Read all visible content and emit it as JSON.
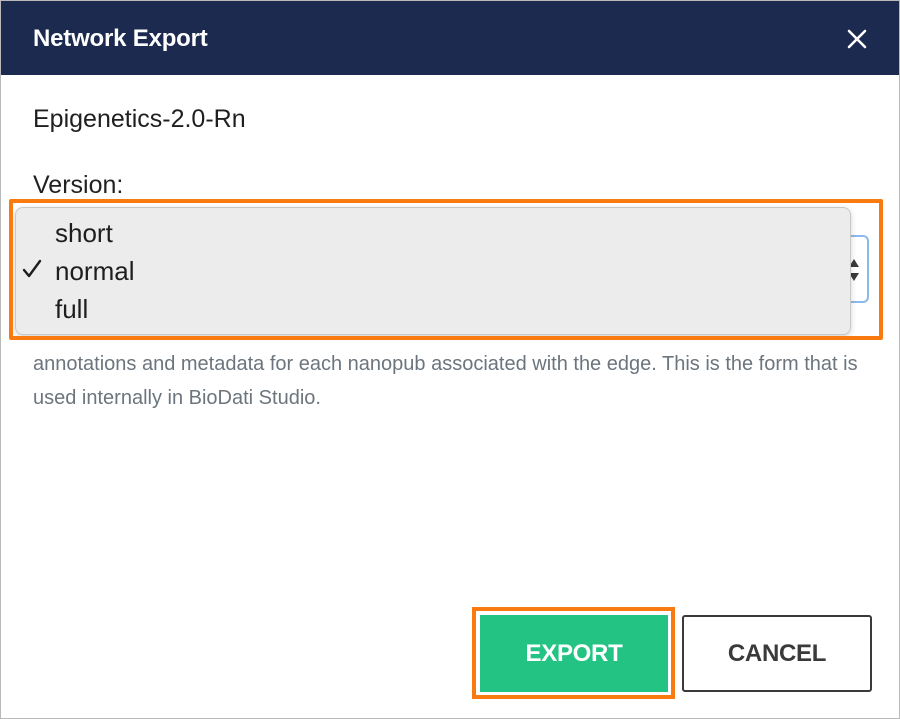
{
  "dialog": {
    "title": "Network Export",
    "close_icon": "close-icon"
  },
  "network": {
    "name": "Epigenetics-2.0-Rn"
  },
  "version": {
    "label": "Version:",
    "selected": "normal",
    "options": [
      "short",
      "normal",
      "full"
    ]
  },
  "description": {
    "text": "annotations and metadata for each nanopub associated with the edge. This is the form that is used internally in BioDati Studio."
  },
  "buttons": {
    "export_label": "EXPORT",
    "cancel_label": "CANCEL"
  },
  "colors": {
    "header": "#1b2a4e",
    "export": "#23c483",
    "highlight": "#f97a10",
    "focus_border": "#8cb8ee"
  }
}
